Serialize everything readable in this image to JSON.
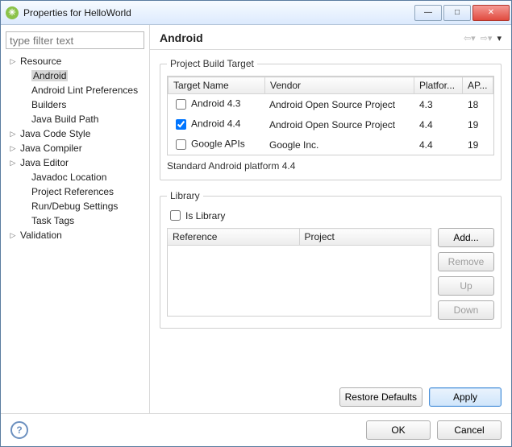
{
  "window": {
    "title": "Properties for HelloWorld"
  },
  "filter": {
    "placeholder": "type filter text"
  },
  "tree": [
    {
      "label": "Resource",
      "expandable": true,
      "indent": 0
    },
    {
      "label": "Android",
      "expandable": false,
      "indent": 1,
      "selected": true
    },
    {
      "label": "Android Lint Preferences",
      "expandable": false,
      "indent": 1
    },
    {
      "label": "Builders",
      "expandable": false,
      "indent": 1
    },
    {
      "label": "Java Build Path",
      "expandable": false,
      "indent": 1
    },
    {
      "label": "Java Code Style",
      "expandable": true,
      "indent": 0
    },
    {
      "label": "Java Compiler",
      "expandable": true,
      "indent": 0
    },
    {
      "label": "Java Editor",
      "expandable": true,
      "indent": 0
    },
    {
      "label": "Javadoc Location",
      "expandable": false,
      "indent": 1
    },
    {
      "label": "Project References",
      "expandable": false,
      "indent": 1
    },
    {
      "label": "Run/Debug Settings",
      "expandable": false,
      "indent": 1
    },
    {
      "label": "Task Tags",
      "expandable": false,
      "indent": 1
    },
    {
      "label": "Validation",
      "expandable": true,
      "indent": 0
    }
  ],
  "page": {
    "title": "Android",
    "build_target": {
      "legend": "Project Build Target",
      "headers": {
        "name": "Target Name",
        "vendor": "Vendor",
        "platform": "Platfor...",
        "api": "AP..."
      },
      "rows": [
        {
          "checked": false,
          "name": "Android 4.3",
          "vendor": "Android Open Source Project",
          "platform": "4.3",
          "api": "18"
        },
        {
          "checked": true,
          "name": "Android 4.4",
          "vendor": "Android Open Source Project",
          "platform": "4.4",
          "api": "19"
        },
        {
          "checked": false,
          "name": "Google APIs",
          "vendor": "Google Inc.",
          "platform": "4.4",
          "api": "19"
        }
      ],
      "standard_text": "Standard Android platform 4.4"
    },
    "library": {
      "legend": "Library",
      "is_library_label": "Is Library",
      "is_library_checked": false,
      "headers": {
        "reference": "Reference",
        "project": "Project"
      },
      "buttons": {
        "add": "Add...",
        "remove": "Remove",
        "up": "Up",
        "down": "Down"
      }
    },
    "actions": {
      "restore": "Restore Defaults",
      "apply": "Apply"
    }
  },
  "footer": {
    "ok": "OK",
    "cancel": "Cancel"
  }
}
